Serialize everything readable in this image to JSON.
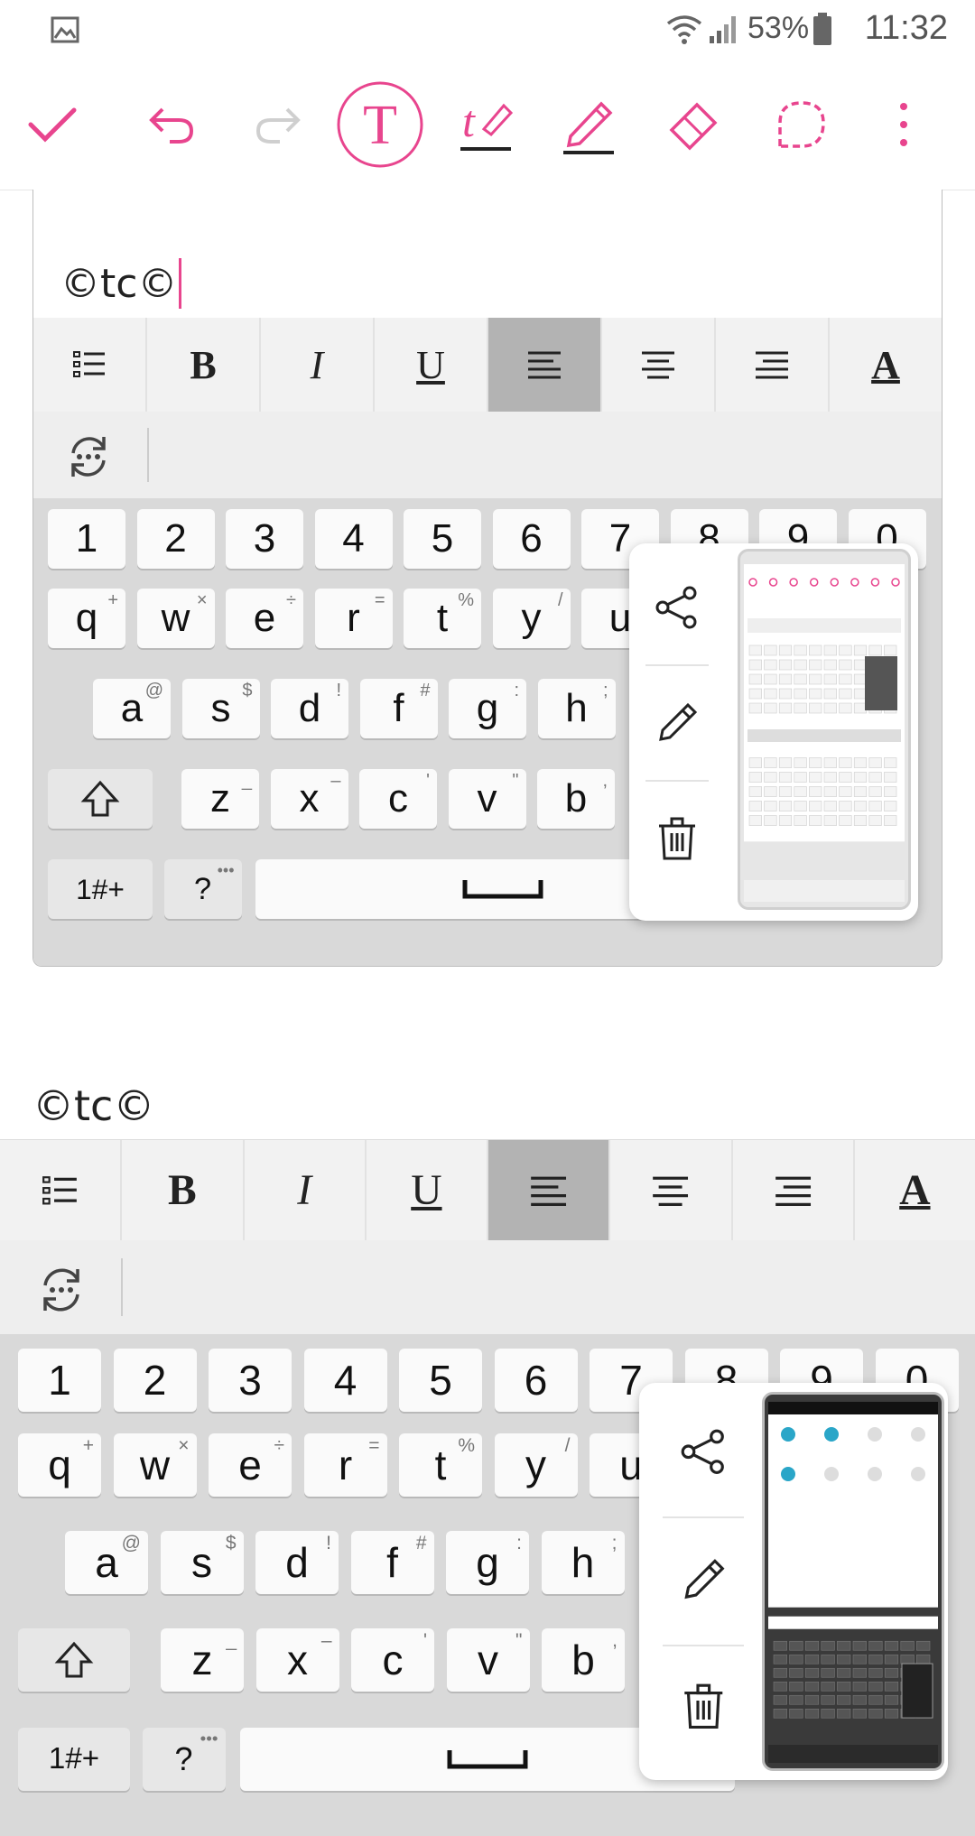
{
  "status_bar": {
    "battery": "53%",
    "time": "11:32"
  },
  "toolbar": {
    "items": [
      "confirm-check",
      "undo",
      "redo",
      "text-mode",
      "handwriting-pen",
      "pen",
      "eraser",
      "lasso",
      "more-options"
    ]
  },
  "colors": {
    "accent": "#e8458e",
    "keyboard_bg": "#d9d9d9",
    "key_bg": "#fafafa",
    "active_format": "#b3b3b3"
  },
  "note": {
    "card_text": "©tc©",
    "page_text": "©tc©"
  },
  "format_bar": {
    "items": [
      "list",
      "B",
      "I",
      "U",
      "align-left",
      "align-center",
      "align-right",
      "A"
    ],
    "active": "align-left"
  },
  "keyboard": {
    "numbers": [
      "1",
      "2",
      "3",
      "4",
      "5",
      "6",
      "7",
      "8",
      "9",
      "0"
    ],
    "row1": [
      {
        "k": "q",
        "h": "+"
      },
      {
        "k": "w",
        "h": "×"
      },
      {
        "k": "e",
        "h": "÷"
      },
      {
        "k": "r",
        "h": "="
      },
      {
        "k": "t",
        "h": "%"
      },
      {
        "k": "y",
        "h": "/"
      },
      {
        "k": "u",
        "h": ""
      }
    ],
    "row2": [
      {
        "k": "a",
        "h": "@"
      },
      {
        "k": "s",
        "h": "$"
      },
      {
        "k": "d",
        "h": "!"
      },
      {
        "k": "f",
        "h": "#"
      },
      {
        "k": "g",
        "h": ":"
      },
      {
        "k": "h",
        "h": ";"
      }
    ],
    "row3": [
      {
        "k": "z",
        "h": "_"
      },
      {
        "k": "x",
        "h": "–"
      },
      {
        "k": "c",
        "h": "'"
      },
      {
        "k": "v",
        "h": "\""
      },
      {
        "k": "b",
        "h": ","
      }
    ],
    "symbols_label": "1#+",
    "question_label": "?",
    "question_hint": "•••"
  },
  "popup_actions": [
    "share",
    "edit",
    "delete"
  ]
}
